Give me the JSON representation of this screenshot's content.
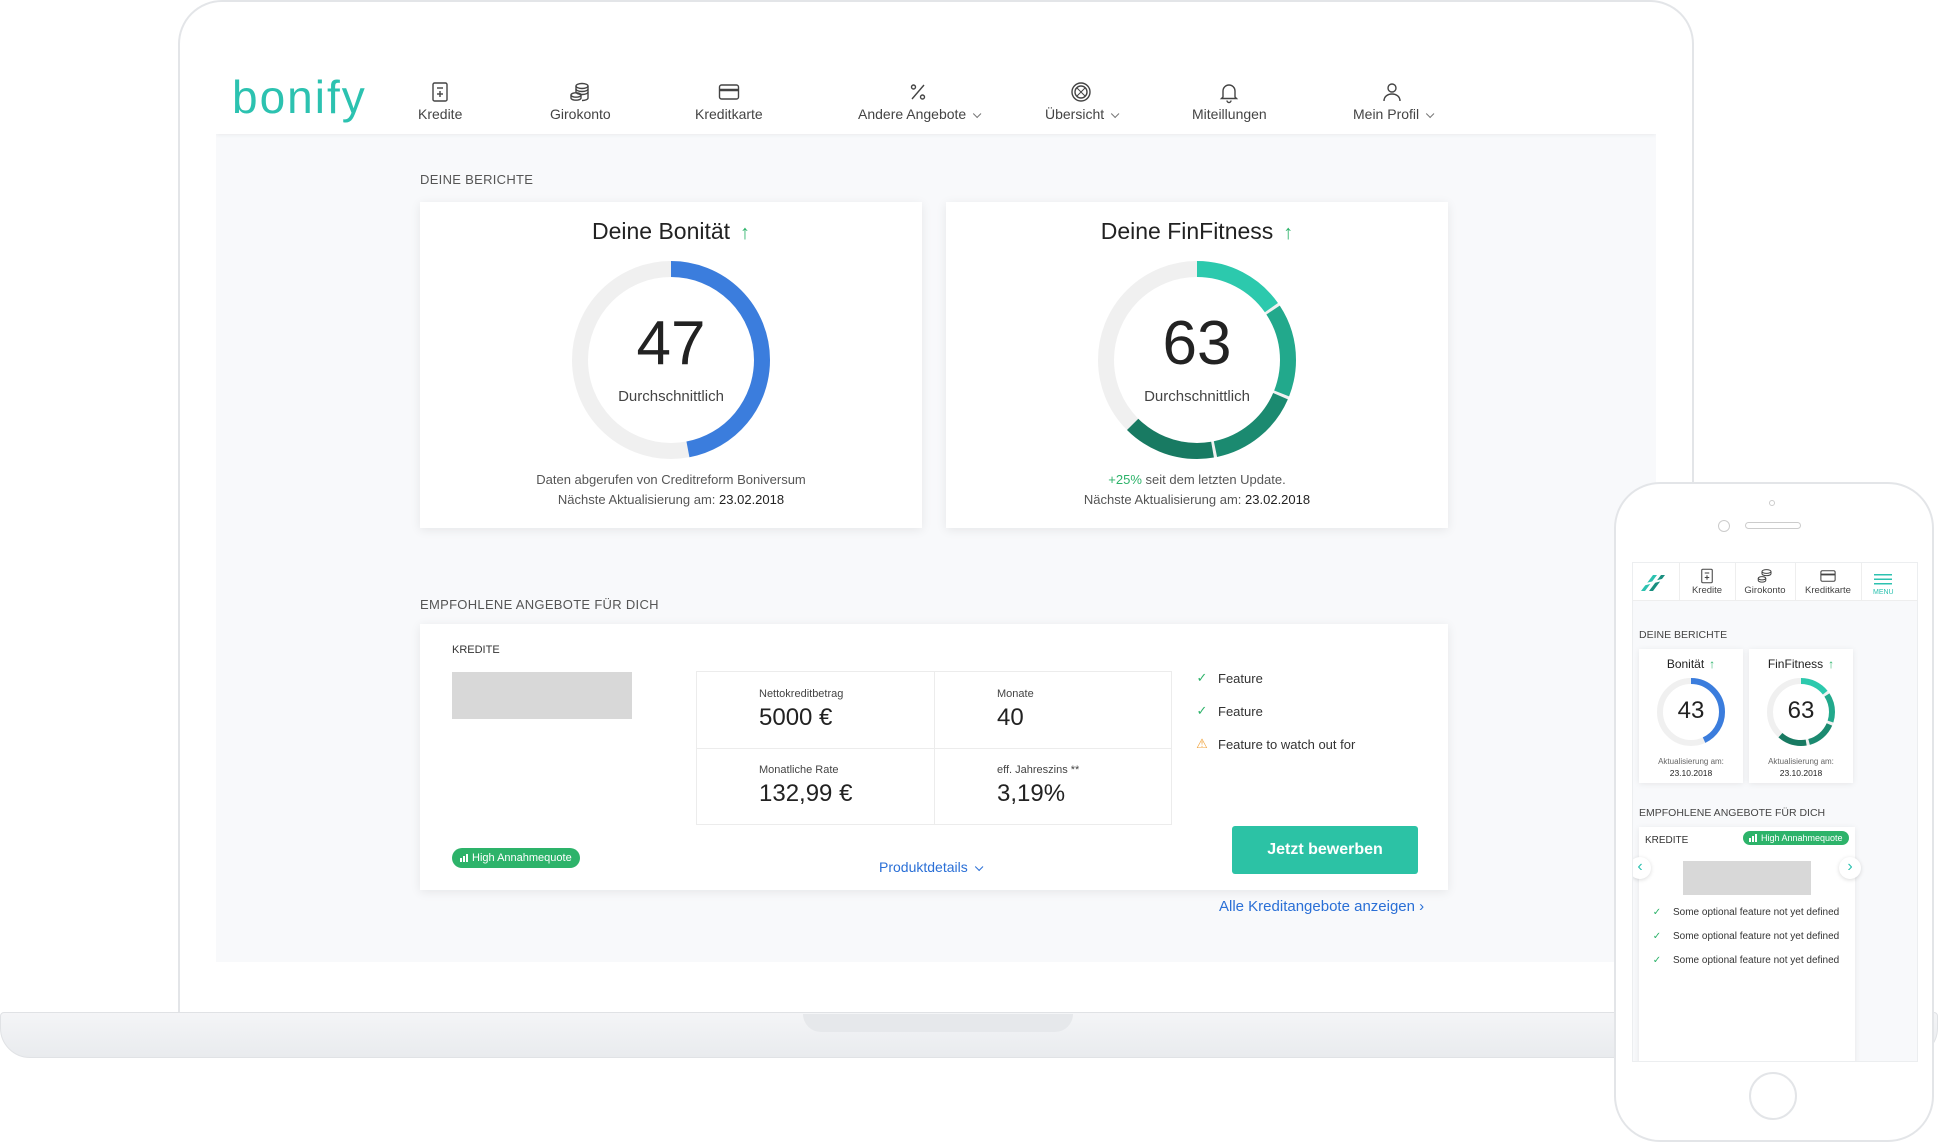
{
  "nav": {
    "logo": "bonify",
    "items": [
      {
        "label": "Kredite",
        "icon": "document-icon"
      },
      {
        "label": "Girokonto",
        "icon": "coins-icon"
      },
      {
        "label": "Kreditkarte",
        "icon": "credit-card-icon"
      },
      {
        "label": "Andere Angebote",
        "icon": "percent-icon"
      },
      {
        "label": "Übersicht",
        "icon": "dial-icon"
      },
      {
        "label": "Miteillungen",
        "icon": "bell-icon"
      },
      {
        "label": "Mein Profil",
        "icon": "user-icon"
      }
    ]
  },
  "reports": {
    "section_label": "DEINE BERICHTE",
    "bonitaet": {
      "title": "Deine Bonität",
      "value": "47",
      "score": 47,
      "rating": "Durchschnittlich",
      "source_line": "Daten abgerufen von Creditreform Boniversum",
      "next_update_label": "Nächste Aktualisierung am:",
      "next_update_date": "23.02.2018",
      "color": "#3b7ddd"
    },
    "finfitness": {
      "title": "Deine FinFitness",
      "value": "63",
      "score": 63,
      "rating": "Durchschnittlich",
      "change": "+25%",
      "change_text": "seit dem letzten Update.",
      "next_update_label": "Nächste Aktualisierung am:",
      "next_update_date": "23.02.2018",
      "colors": [
        "#2cc9ad",
        "#22a98c",
        "#1b8a70",
        "#187a62"
      ]
    }
  },
  "offers": {
    "section_label": "EMPFOHLENE ANGEBOTE FÜR DICH",
    "category": "KREDITE",
    "metrics": {
      "net_label": "Nettokreditbetrag",
      "net_value": "5000 €",
      "months_label": "Monate",
      "months_value": "40",
      "rate_label": "Monatliche Rate",
      "rate_value": "132,99 €",
      "interest_label": "eff. Jahreszins **",
      "interest_value": "3,19%"
    },
    "features": [
      {
        "text": "Feature",
        "icon": "check-icon"
      },
      {
        "text": "Feature",
        "icon": "check-icon"
      },
      {
        "text": "Feature to watch out for",
        "icon": "warning-icon"
      }
    ],
    "badge": "High Annahmequote",
    "details_link": "Produktdetails",
    "apply_button": "Jetzt bewerben",
    "all_offers_link": "Alle Kreditangebote anzeigen"
  },
  "mobile": {
    "nav": [
      {
        "label": "Kredite"
      },
      {
        "label": "Girokonto"
      },
      {
        "label": "Kreditkarte"
      }
    ],
    "menu_label": "MENU",
    "reports_label": "DEINE BERICHTE",
    "bonitaet": {
      "title": "Bonität",
      "value": "43",
      "score": 43,
      "update_label": "Aktualisierung am:",
      "update_date": "23.10.2018"
    },
    "finfitness": {
      "title": "FinFitness",
      "value": "63",
      "score": 63,
      "update_label": "Aktualisierung am:",
      "update_date": "23.10.2018"
    },
    "offers_label": "EMPFOHLENE ANGEBOTE FÜR DICH",
    "category": "KREDITE",
    "badge": "High Annahmequote",
    "features": [
      "Some optional feature not yet defined",
      "Some optional feature not yet defined",
      "Some optional feature not yet defined"
    ]
  }
}
